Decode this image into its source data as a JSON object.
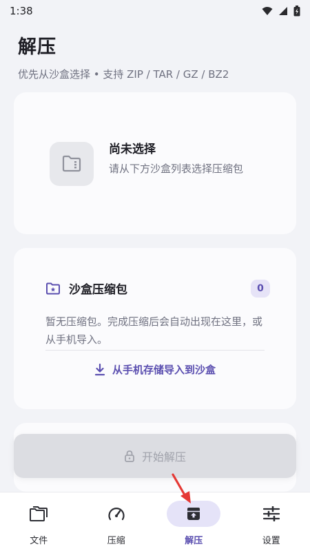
{
  "status_bar": {
    "time": "1:38"
  },
  "header": {
    "title": "解压",
    "subtitle": "优先从沙盒选择 • 支持 ZIP / TAR / GZ / BZ2"
  },
  "selection": {
    "title": "尚未选择",
    "description": "请从下方沙盒列表选择压缩包"
  },
  "sandbox": {
    "title": "沙盒压缩包",
    "count": "0",
    "empty_text": "暂无压缩包。完成压缩后会自动出现在这里，或从手机导入。",
    "import_label": "从手机存储导入到沙盒"
  },
  "actions": {
    "start_label": "开始解压"
  },
  "nav": {
    "items": [
      {
        "label": "文件",
        "icon": "folder-icon"
      },
      {
        "label": "压缩",
        "icon": "gauge-icon"
      },
      {
        "label": "解压",
        "icon": "archive-icon",
        "active": true
      },
      {
        "label": "设置",
        "icon": "sliders-icon"
      }
    ]
  },
  "colors": {
    "accent": "#5b4fb0",
    "accent_soft": "#e5e3f8",
    "background": "#f2f3f7"
  }
}
